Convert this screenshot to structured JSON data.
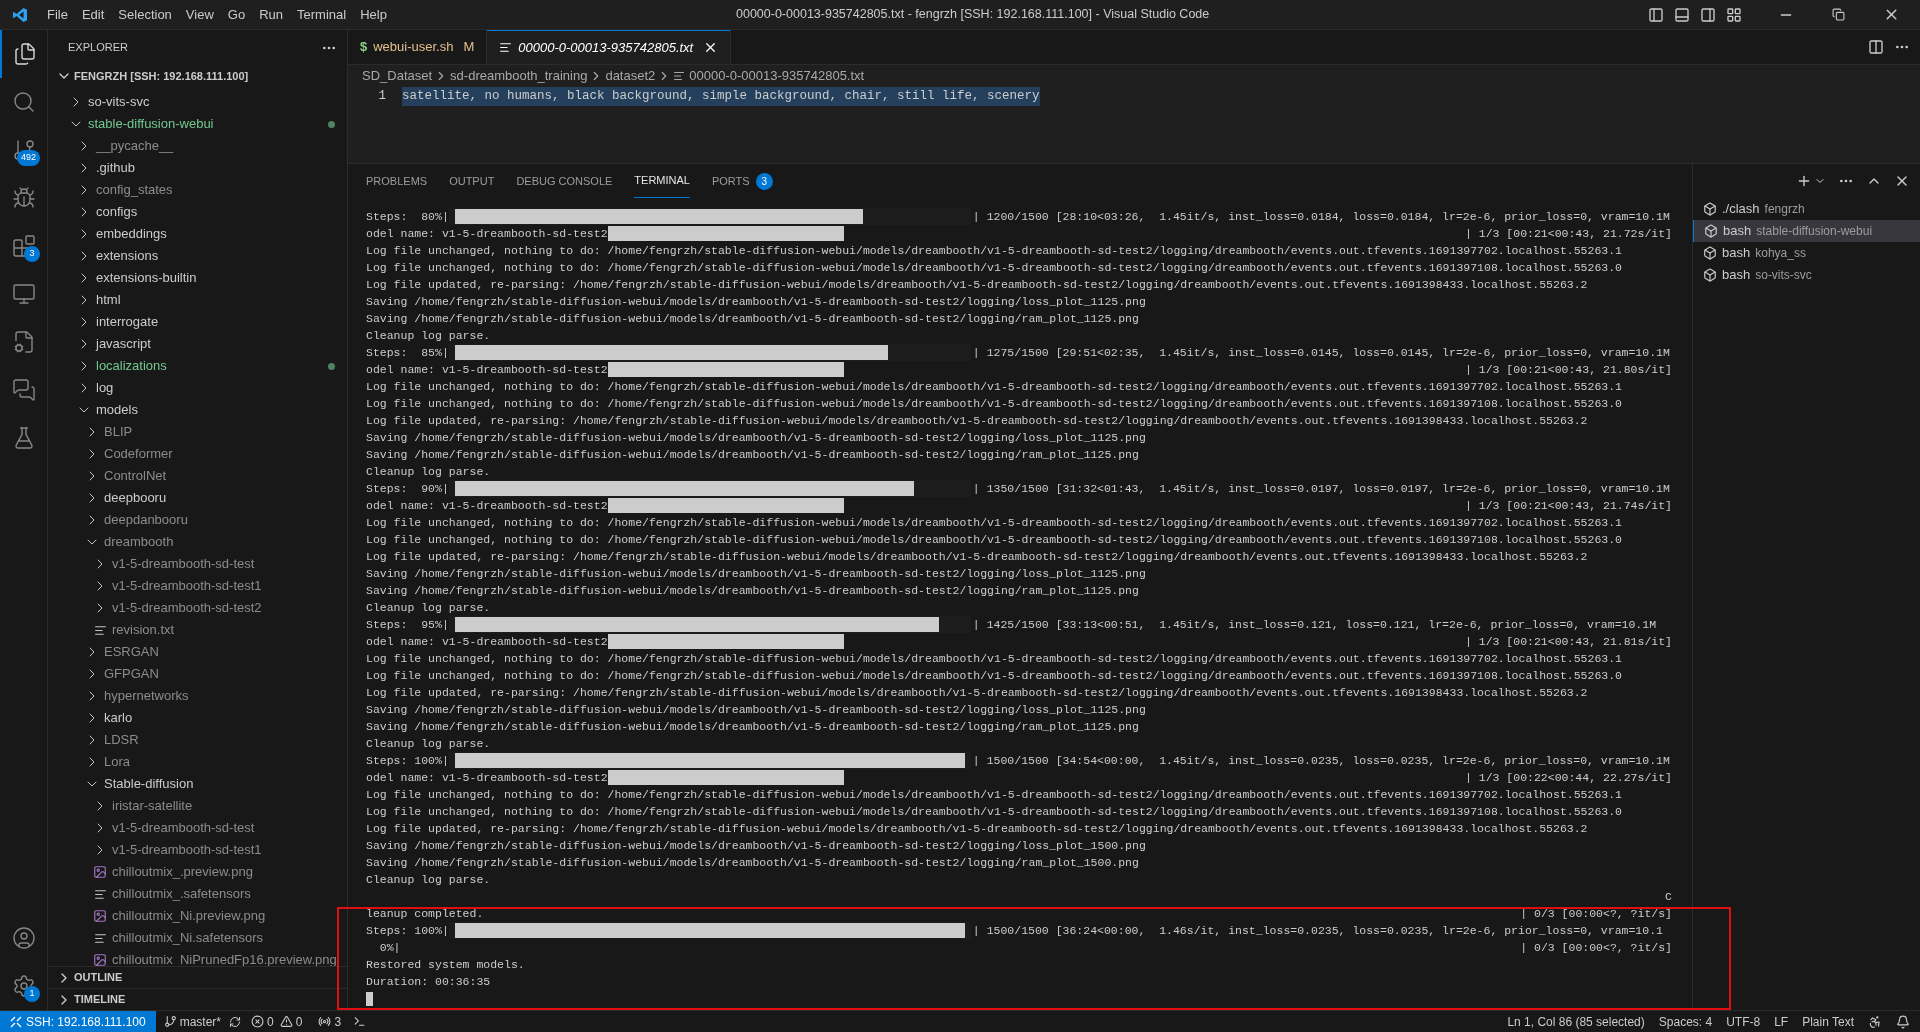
{
  "window": {
    "title": "00000-0-00013-935742805.txt - fengrzh [SSH: 192.168.111.100] - Visual Studio Code"
  },
  "menu": [
    "File",
    "Edit",
    "Selection",
    "View",
    "Go",
    "Run",
    "Terminal",
    "Help"
  ],
  "activity_bar": {
    "badges": {
      "source_control": "492",
      "extensions": "3",
      "settings": "1"
    }
  },
  "sidebar": {
    "title": "EXPLORER",
    "root": "FENGRZH [SSH: 192.168.111.100]",
    "tree": [
      {
        "label": "so-vits-svc",
        "kind": "folder",
        "expanded": false,
        "ignored": false,
        "modified": false
      },
      {
        "label": "stable-diffusion-webui",
        "kind": "folder",
        "expanded": true,
        "ignored": false,
        "modified": true,
        "children": [
          {
            "label": "__pycache__",
            "kind": "folder",
            "expanded": false,
            "ignored": true,
            "modified": false
          },
          {
            "label": ".github",
            "kind": "folder",
            "expanded": false,
            "ignored": false,
            "modified": false
          },
          {
            "label": "config_states",
            "kind": "folder",
            "expanded": false,
            "ignored": true,
            "modified": false
          },
          {
            "label": "configs",
            "kind": "folder",
            "expanded": false,
            "ignored": false,
            "modified": false
          },
          {
            "label": "embeddings",
            "kind": "folder",
            "expanded": false,
            "ignored": false,
            "modified": false
          },
          {
            "label": "extensions",
            "kind": "folder",
            "expanded": false,
            "ignored": false,
            "modified": false
          },
          {
            "label": "extensions-builtin",
            "kind": "folder",
            "expanded": false,
            "ignored": false,
            "modified": false
          },
          {
            "label": "html",
            "kind": "folder",
            "expanded": false,
            "ignored": false,
            "modified": false
          },
          {
            "label": "interrogate",
            "kind": "folder",
            "expanded": false,
            "ignored": false,
            "modified": false
          },
          {
            "label": "javascript",
            "kind": "folder",
            "expanded": false,
            "ignored": false,
            "modified": false
          },
          {
            "label": "localizations",
            "kind": "folder",
            "expanded": false,
            "ignored": false,
            "modified": true
          },
          {
            "label": "log",
            "kind": "folder",
            "expanded": false,
            "ignored": false,
            "modified": false
          },
          {
            "label": "models",
            "kind": "folder",
            "expanded": true,
            "ignored": false,
            "modified": false,
            "children": [
              {
                "label": "BLIP",
                "kind": "folder",
                "expanded": false,
                "ignored": true,
                "modified": false
              },
              {
                "label": "Codeformer",
                "kind": "folder",
                "expanded": false,
                "ignored": true,
                "modified": false
              },
              {
                "label": "ControlNet",
                "kind": "folder",
                "expanded": false,
                "ignored": true,
                "modified": false
              },
              {
                "label": "deepbooru",
                "kind": "folder",
                "expanded": false,
                "ignored": false,
                "modified": false
              },
              {
                "label": "deepdanbooru",
                "kind": "folder",
                "expanded": false,
                "ignored": true,
                "modified": false
              },
              {
                "label": "dreambooth",
                "kind": "folder",
                "expanded": true,
                "ignored": true,
                "modified": false,
                "children": [
                  {
                    "label": "v1-5-dreambooth-sd-test",
                    "kind": "folder",
                    "expanded": false,
                    "ignored": true,
                    "modified": false
                  },
                  {
                    "label": "v1-5-dreambooth-sd-test1",
                    "kind": "folder",
                    "expanded": false,
                    "ignored": true,
                    "modified": false
                  },
                  {
                    "label": "v1-5-dreambooth-sd-test2",
                    "kind": "folder",
                    "expanded": false,
                    "ignored": true,
                    "modified": false
                  },
                  {
                    "label": "revision.txt",
                    "kind": "file",
                    "ignored": true,
                    "modified": false
                  }
                ]
              },
              {
                "label": "ESRGAN",
                "kind": "folder",
                "expanded": false,
                "ignored": true,
                "modified": false
              },
              {
                "label": "GFPGAN",
                "kind": "folder",
                "expanded": false,
                "ignored": true,
                "modified": false
              },
              {
                "label": "hypernetworks",
                "kind": "folder",
                "expanded": false,
                "ignored": true,
                "modified": false
              },
              {
                "label": "karlo",
                "kind": "folder",
                "expanded": false,
                "ignored": false,
                "modified": false
              },
              {
                "label": "LDSR",
                "kind": "folder",
                "expanded": false,
                "ignored": true,
                "modified": false
              },
              {
                "label": "Lora",
                "kind": "folder",
                "expanded": false,
                "ignored": true,
                "modified": false
              },
              {
                "label": "Stable-diffusion",
                "kind": "folder",
                "expanded": true,
                "ignored": false,
                "modified": false,
                "children": [
                  {
                    "label": "iristar-satellite",
                    "kind": "folder",
                    "expanded": false,
                    "ignored": true,
                    "modified": false
                  },
                  {
                    "label": "v1-5-dreambooth-sd-test",
                    "kind": "folder",
                    "expanded": false,
                    "ignored": true,
                    "modified": false
                  },
                  {
                    "label": "v1-5-dreambooth-sd-test1",
                    "kind": "folder",
                    "expanded": false,
                    "ignored": true,
                    "modified": false
                  },
                  {
                    "label": "chilloutmix_.preview.png",
                    "kind": "image",
                    "ignored": true,
                    "modified": false
                  },
                  {
                    "label": "chilloutmix_.safetensors",
                    "kind": "file",
                    "ignored": true,
                    "modified": false
                  },
                  {
                    "label": "chilloutmix_Ni.preview.png",
                    "kind": "image",
                    "ignored": true,
                    "modified": false
                  },
                  {
                    "label": "chilloutmix_Ni.safetensors",
                    "kind": "file",
                    "ignored": true,
                    "modified": false
                  },
                  {
                    "label": "chilloutmix_NiPrunedFp16.preview.png",
                    "kind": "image",
                    "ignored": true,
                    "modified": false
                  }
                ]
              }
            ]
          }
        ]
      }
    ],
    "sections": [
      "OUTLINE",
      "TIMELINE"
    ]
  },
  "editor": {
    "tabs": [
      {
        "icon": "$",
        "label": "webui-user.sh",
        "badge": "M",
        "selected": false,
        "preview": false
      },
      {
        "label": "00000-0-00013-935742805.txt",
        "selected": true,
        "preview": true
      }
    ],
    "breadcrumbs": [
      "SD_Dataset",
      "sd-dreambooth_training",
      "dataset2",
      "00000-0-00013-935742805.txt"
    ],
    "lines": [
      {
        "number": "1",
        "text": "satellite, no humans, black background, simple background, chair, still life, scenery",
        "selected": true
      }
    ]
  },
  "panel": {
    "tabs": [
      {
        "label": "PROBLEMS",
        "selected": false
      },
      {
        "label": "OUTPUT",
        "selected": false
      },
      {
        "label": "DEBUG CONSOLE",
        "selected": false
      },
      {
        "label": "TERMINAL",
        "selected": true
      },
      {
        "label": "PORTS",
        "badge": "3",
        "selected": false
      }
    ],
    "terminal_lines": [
      {
        "kind": "progress",
        "prefix": "Steps:  80%|",
        "level": 0.8,
        "suffix": "| 1200/1500 [28:10<03:26,  1.45it/s, inst_loss=0.0184, loss=0.0184, lr=2e-6, prior_loss=0, vram=10.1M"
      },
      {
        "kind": "model",
        "text": "odel name: v1-5-dreambooth-sd-test2",
        "right": "| 1/3 [00:21<00:43, 21.72s/it]"
      },
      {
        "kind": "text",
        "text": "Log file unchanged, nothing to do: /home/fengrzh/stable-diffusion-webui/models/dreambooth/v1-5-dreambooth-sd-test2/logging/dreambooth/events.out.tfevents.1691397702.localhost.55263.1"
      },
      {
        "kind": "text",
        "text": "Log file unchanged, nothing to do: /home/fengrzh/stable-diffusion-webui/models/dreambooth/v1-5-dreambooth-sd-test2/logging/dreambooth/events.out.tfevents.1691397108.localhost.55263.0"
      },
      {
        "kind": "text",
        "text": "Log file updated, re-parsing: /home/fengrzh/stable-diffusion-webui/models/dreambooth/v1-5-dreambooth-sd-test2/logging/dreambooth/events.out.tfevents.1691398433.localhost.55263.2"
      },
      {
        "kind": "text",
        "text": "Saving /home/fengrzh/stable-diffusion-webui/models/dreambooth/v1-5-dreambooth-sd-test2/logging/loss_plot_1125.png"
      },
      {
        "kind": "text",
        "text": "Saving /home/fengrzh/stable-diffusion-webui/models/dreambooth/v1-5-dreambooth-sd-test2/logging/ram_plot_1125.png"
      },
      {
        "kind": "text",
        "text": "Cleanup log parse."
      },
      {
        "kind": "progress",
        "prefix": "Steps:  85%|",
        "level": 0.85,
        "suffix": "| 1275/1500 [29:51<02:35,  1.45it/s, inst_loss=0.0145, loss=0.0145, lr=2e-6, prior_loss=0, vram=10.1M"
      },
      {
        "kind": "model",
        "text": "odel name: v1-5-dreambooth-sd-test2",
        "right": "| 1/3 [00:21<00:43, 21.80s/it]"
      },
      {
        "kind": "text",
        "text": "Log file unchanged, nothing to do: /home/fengrzh/stable-diffusion-webui/models/dreambooth/v1-5-dreambooth-sd-test2/logging/dreambooth/events.out.tfevents.1691397702.localhost.55263.1"
      },
      {
        "kind": "text",
        "text": "Log file unchanged, nothing to do: /home/fengrzh/stable-diffusion-webui/models/dreambooth/v1-5-dreambooth-sd-test2/logging/dreambooth/events.out.tfevents.1691397108.localhost.55263.0"
      },
      {
        "kind": "text",
        "text": "Log file updated, re-parsing: /home/fengrzh/stable-diffusion-webui/models/dreambooth/v1-5-dreambooth-sd-test2/logging/dreambooth/events.out.tfevents.1691398433.localhost.55263.2"
      },
      {
        "kind": "text",
        "text": "Saving /home/fengrzh/stable-diffusion-webui/models/dreambooth/v1-5-dreambooth-sd-test2/logging/loss_plot_1125.png"
      },
      {
        "kind": "text",
        "text": "Saving /home/fengrzh/stable-diffusion-webui/models/dreambooth/v1-5-dreambooth-sd-test2/logging/ram_plot_1125.png"
      },
      {
        "kind": "text",
        "text": "Cleanup log parse."
      },
      {
        "kind": "progress",
        "prefix": "Steps:  90%|",
        "level": 0.9,
        "suffix": "| 1350/1500 [31:32<01:43,  1.45it/s, inst_loss=0.0197, loss=0.0197, lr=2e-6, prior_loss=0, vram=10.1M"
      },
      {
        "kind": "model",
        "text": "odel name: v1-5-dreambooth-sd-test2",
        "right": "| 1/3 [00:21<00:43, 21.74s/it]"
      },
      {
        "kind": "text",
        "text": "Log file unchanged, nothing to do: /home/fengrzh/stable-diffusion-webui/models/dreambooth/v1-5-dreambooth-sd-test2/logging/dreambooth/events.out.tfevents.1691397702.localhost.55263.1"
      },
      {
        "kind": "text",
        "text": "Log file unchanged, nothing to do: /home/fengrzh/stable-diffusion-webui/models/dreambooth/v1-5-dreambooth-sd-test2/logging/dreambooth/events.out.tfevents.1691397108.localhost.55263.0"
      },
      {
        "kind": "text",
        "text": "Log file updated, re-parsing: /home/fengrzh/stable-diffusion-webui/models/dreambooth/v1-5-dreambooth-sd-test2/logging/dreambooth/events.out.tfevents.1691398433.localhost.55263.2"
      },
      {
        "kind": "text",
        "text": "Saving /home/fengrzh/stable-diffusion-webui/models/dreambooth/v1-5-dreambooth-sd-test2/logging/loss_plot_1125.png"
      },
      {
        "kind": "text",
        "text": "Saving /home/fengrzh/stable-diffusion-webui/models/dreambooth/v1-5-dreambooth-sd-test2/logging/ram_plot_1125.png"
      },
      {
        "kind": "text",
        "text": "Cleanup log parse."
      },
      {
        "kind": "progress",
        "prefix": "Steps:  95%|",
        "level": 0.95,
        "suffix": "| 1425/1500 [33:13<00:51,  1.45it/s, inst_loss=0.121, loss=0.121, lr=2e-6, prior_loss=0, vram=10.1M"
      },
      {
        "kind": "model",
        "text": "odel name: v1-5-dreambooth-sd-test2",
        "right": "| 1/3 [00:21<00:43, 21.81s/it]"
      },
      {
        "kind": "text",
        "text": "Log file unchanged, nothing to do: /home/fengrzh/stable-diffusion-webui/models/dreambooth/v1-5-dreambooth-sd-test2/logging/dreambooth/events.out.tfevents.1691397702.localhost.55263.1"
      },
      {
        "kind": "text",
        "text": "Log file unchanged, nothing to do: /home/fengrzh/stable-diffusion-webui/models/dreambooth/v1-5-dreambooth-sd-test2/logging/dreambooth/events.out.tfevents.1691397108.localhost.55263.0"
      },
      {
        "kind": "text",
        "text": "Log file updated, re-parsing: /home/fengrzh/stable-diffusion-webui/models/dreambooth/v1-5-dreambooth-sd-test2/logging/dreambooth/events.out.tfevents.1691398433.localhost.55263.2"
      },
      {
        "kind": "text",
        "text": "Saving /home/fengrzh/stable-diffusion-webui/models/dreambooth/v1-5-dreambooth-sd-test2/logging/loss_plot_1125.png"
      },
      {
        "kind": "text",
        "text": "Saving /home/fengrzh/stable-diffusion-webui/models/dreambooth/v1-5-dreambooth-sd-test2/logging/ram_plot_1125.png"
      },
      {
        "kind": "text",
        "text": "Cleanup log parse."
      },
      {
        "kind": "progress",
        "prefix": "Steps: 100%|",
        "level": 1,
        "suffix": "| 1500/1500 [34:54<00:00,  1.45it/s, inst_loss=0.0235, loss=0.0235, lr=2e-6, prior_loss=0, vram=10.1M"
      },
      {
        "kind": "model",
        "text": "odel name: v1-5-dreambooth-sd-test2",
        "right": "| 1/3 [00:22<00:44, 22.27s/it]"
      },
      {
        "kind": "text",
        "text": "Log file unchanged, nothing to do: /home/fengrzh/stable-diffusion-webui/models/dreambooth/v1-5-dreambooth-sd-test2/logging/dreambooth/events.out.tfevents.1691397702.localhost.55263.1"
      },
      {
        "kind": "text",
        "text": "Log file unchanged, nothing to do: /home/fengrzh/stable-diffusion-webui/models/dreambooth/v1-5-dreambooth-sd-test2/logging/dreambooth/events.out.tfevents.1691397108.localhost.55263.0"
      },
      {
        "kind": "text",
        "text": "Log file updated, re-parsing: /home/fengrzh/stable-diffusion-webui/models/dreambooth/v1-5-dreambooth-sd-test2/logging/dreambooth/events.out.tfevents.1691398433.localhost.55263.2"
      },
      {
        "kind": "text",
        "text": "Saving /home/fengrzh/stable-diffusion-webui/models/dreambooth/v1-5-dreambooth-sd-test2/logging/loss_plot_1500.png"
      },
      {
        "kind": "text",
        "text": "Saving /home/fengrzh/stable-diffusion-webui/models/dreambooth/v1-5-dreambooth-sd-test2/logging/ram_plot_1500.png"
      },
      {
        "kind": "text",
        "text": "Cleanup log parse."
      },
      {
        "kind": "split",
        "right": "C"
      },
      {
        "kind": "split",
        "text": "leanup completed.",
        "right": "| 0/3 [00:00<?, ?it/s]"
      },
      {
        "kind": "progress",
        "prefix": "Steps: 100%|",
        "level": 1,
        "suffix": "| 1500/1500 [36:24<00:00,  1.46s/it, inst_loss=0.0235, loss=0.0235, lr=2e-6, prior_loss=0, vram=10.1"
      },
      {
        "kind": "split",
        "text": "  0%|",
        "right": "| 0/3 [00:00<?, ?it/s]"
      },
      {
        "kind": "text",
        "text": "Restored system models."
      },
      {
        "kind": "text",
        "text": "Duration: 00:36:35"
      },
      {
        "kind": "cursor"
      }
    ],
    "terminals": [
      {
        "name": "./clash",
        "detail": "fengrzh",
        "selected": false
      },
      {
        "name": "bash",
        "detail": "stable-diffusion-webui",
        "selected": true
      },
      {
        "name": "bash",
        "detail": "kohya_ss",
        "selected": false
      },
      {
        "name": "bash",
        "detail": "so-vits-svc",
        "selected": false
      }
    ]
  },
  "status_bar": {
    "remote": "SSH: 192.168.111.100",
    "branch": "master*",
    "errors": "0",
    "warnings": "0",
    "ports": "3",
    "right": [
      "Ln 1, Col 86 (85 selected)",
      "Spaces: 4",
      "UTF-8",
      "LF",
      "Plain Text"
    ]
  }
}
